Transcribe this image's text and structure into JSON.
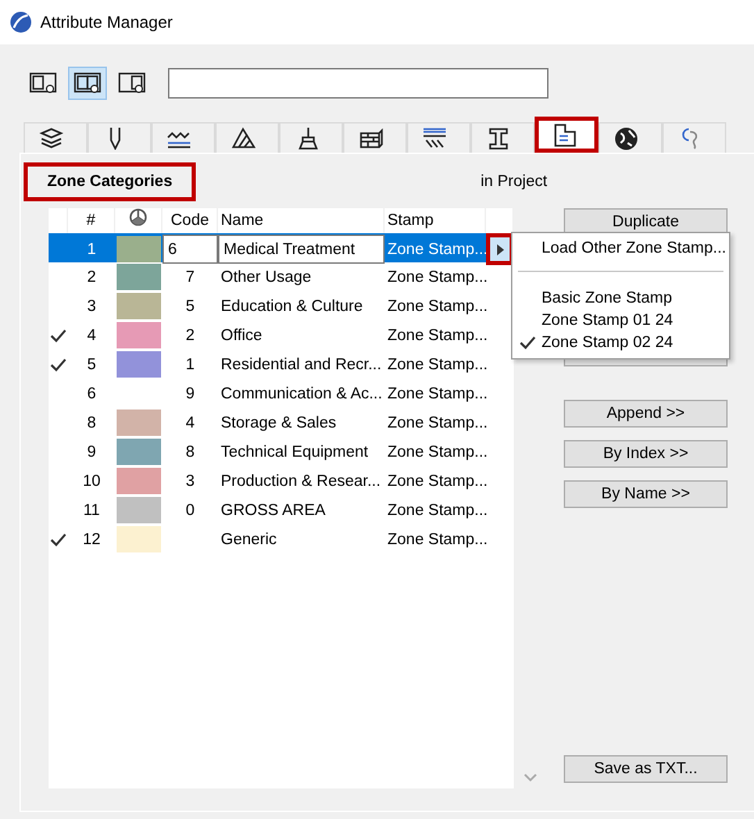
{
  "window": {
    "title": "Attribute Manager"
  },
  "view_buttons": [
    {
      "kind": "left",
      "selected": false
    },
    {
      "kind": "both",
      "selected": true
    },
    {
      "kind": "right",
      "selected": false
    }
  ],
  "tabs": [
    {
      "kind": "layers",
      "selected": false
    },
    {
      "kind": "pen",
      "selected": false
    },
    {
      "kind": "line",
      "selected": false
    },
    {
      "kind": "fill",
      "selected": false
    },
    {
      "kind": "brush",
      "selected": false
    },
    {
      "kind": "material",
      "selected": false
    },
    {
      "kind": "composite",
      "selected": false
    },
    {
      "kind": "profile",
      "selected": false
    },
    {
      "kind": "zone",
      "selected": true
    },
    {
      "kind": "globe",
      "selected": false
    },
    {
      "kind": "operation",
      "selected": false
    }
  ],
  "panel": {
    "title": "Zone Categories",
    "scope": "in Project"
  },
  "table": {
    "columns": [
      "#",
      "Code",
      "Name",
      "Stamp"
    ],
    "rows": [
      {
        "checked": false,
        "selected": true,
        "index": "1",
        "color": "#9aaf8c",
        "code": "6",
        "name": "Medical Treatment",
        "stamp": "Zone Stamp..."
      },
      {
        "checked": false,
        "selected": false,
        "index": "2",
        "color": "#7da59a",
        "code": "7",
        "name": "Other Usage",
        "stamp": "Zone Stamp..."
      },
      {
        "checked": false,
        "selected": false,
        "index": "3",
        "color": "#b9b696",
        "code": "5",
        "name": "Education & Culture",
        "stamp": "Zone Stamp..."
      },
      {
        "checked": true,
        "selected": false,
        "index": "4",
        "color": "#e69ab5",
        "code": "2",
        "name": "Office",
        "stamp": "Zone Stamp..."
      },
      {
        "checked": true,
        "selected": false,
        "index": "5",
        "color": "#9292da",
        "code": "1",
        "name": "Residential and Recr...",
        "stamp": "Zone Stamp..."
      },
      {
        "checked": false,
        "selected": false,
        "index": "6",
        "code": "9",
        "name": "Communication & Ac...",
        "stamp": "Zone Stamp..."
      },
      {
        "checked": false,
        "selected": false,
        "index": "8",
        "color": "#d2b3a8",
        "code": "4",
        "name": "Storage & Sales",
        "stamp": "Zone Stamp..."
      },
      {
        "checked": false,
        "selected": false,
        "index": "9",
        "color": "#7fa6b1",
        "code": "8",
        "name": "Technical Equipment",
        "stamp": "Zone Stamp..."
      },
      {
        "checked": false,
        "selected": false,
        "index": "10",
        "color": "#e0a1a3",
        "code": "3",
        "name": "Production & Resear...",
        "stamp": "Zone Stamp..."
      },
      {
        "checked": false,
        "selected": false,
        "index": "11",
        "color": "#c0c0c0",
        "code": "0",
        "name": "GROSS AREA",
        "stamp": "Zone Stamp..."
      },
      {
        "checked": true,
        "selected": false,
        "index": "12",
        "color": "#fcf1d0",
        "name": "Generic",
        "stamp": "Zone Stamp..."
      }
    ]
  },
  "stamp_menu": {
    "items": [
      {
        "kind": "action",
        "label": "Load Other Zone Stamp...",
        "checked": false
      },
      {
        "kind": "separator"
      },
      {
        "kind": "option",
        "label": "Basic Zone Stamp",
        "checked": false
      },
      {
        "kind": "option",
        "label": "Zone Stamp 01 24",
        "checked": false
      },
      {
        "kind": "option",
        "label": "Zone Stamp 02 24",
        "checked": true
      }
    ]
  },
  "buttons_top": [
    "Duplicate"
  ],
  "buttons_middle": [
    "Append >>",
    "By Index >>",
    "By Name >>"
  ],
  "button_bottom": "Save as TXT..."
}
